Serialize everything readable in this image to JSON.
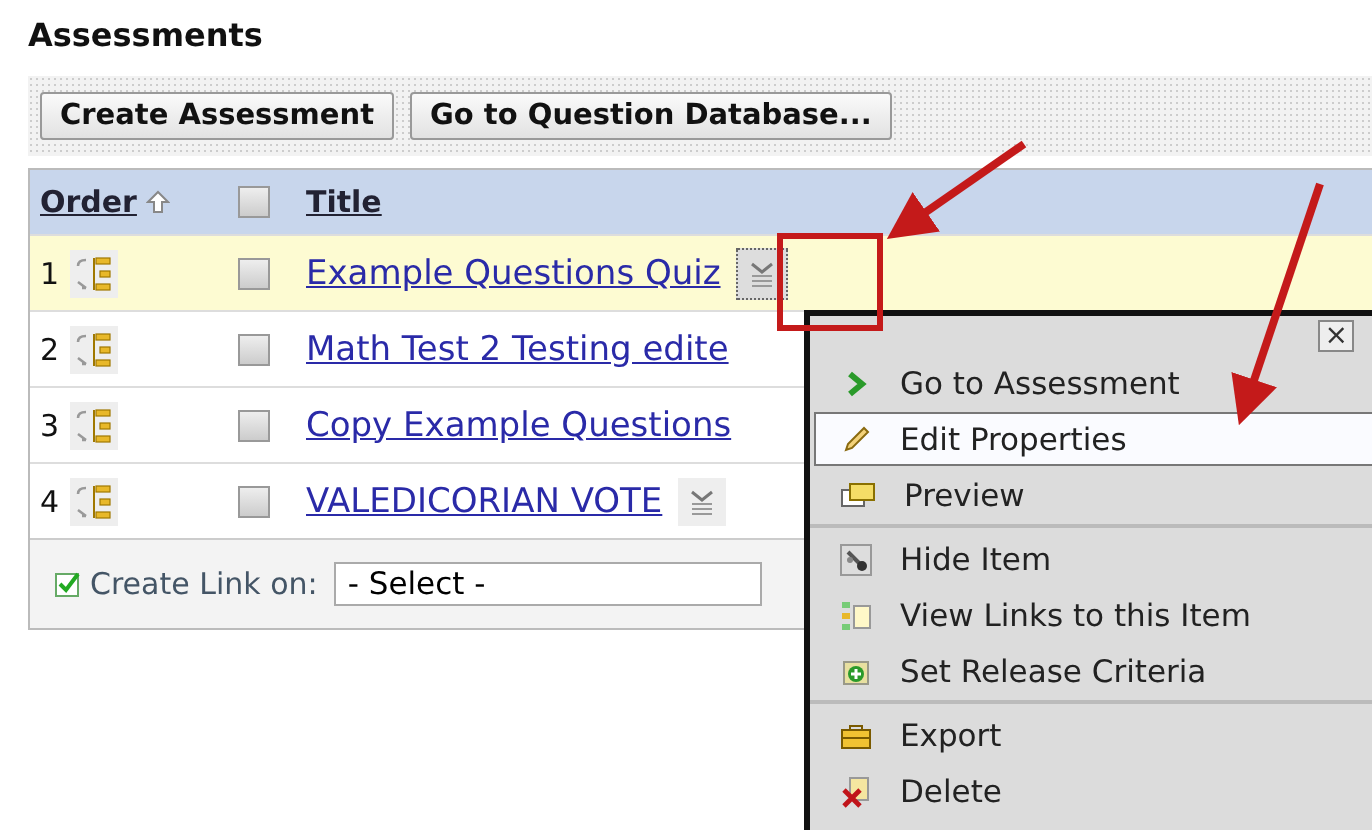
{
  "title": "Assessments",
  "buttons": [
    "Create Assessment",
    "Go to Question Database..."
  ],
  "table": {
    "select_all_checked": false,
    "columns": [
      {
        "label": "Order",
        "sorted": true
      },
      {
        "label": "Title"
      }
    ],
    "rows": [
      {
        "order": "1",
        "title": "Example Questions Quiz",
        "checked": false,
        "selected": true,
        "menu_button": true
      },
      {
        "order": "2",
        "title": "Math Test 2 Testing edite",
        "checked": false,
        "selected": false,
        "menu_button": false
      },
      {
        "order": "3",
        "title": "Copy Example Questions",
        "checked": false,
        "selected": false,
        "menu_button": false
      },
      {
        "order": "4",
        "title": "VALEDICORIAN VOTE",
        "checked": false,
        "selected": false,
        "menu_button": true
      }
    ]
  },
  "create_link": {
    "label": "Create Link on:",
    "select": "- Select -"
  },
  "menu": {
    "close": "×",
    "groups": [
      [
        {
          "label": "Go to Assessment",
          "kind": "go",
          "selected": false
        },
        {
          "label": "Edit Properties",
          "kind": "edit",
          "selected": true
        },
        {
          "label": "Preview",
          "kind": "preview",
          "selected": false
        }
      ],
      [
        {
          "label": "Hide Item",
          "kind": "hide",
          "selected": false
        },
        {
          "label": "View Links to this Item",
          "kind": "links",
          "selected": false
        },
        {
          "label": "Set Release Criteria",
          "kind": "release",
          "selected": false
        }
      ],
      [
        {
          "label": "Export",
          "kind": "export",
          "selected": false
        },
        {
          "label": "Delete",
          "kind": "delete",
          "selected": false
        }
      ]
    ]
  }
}
